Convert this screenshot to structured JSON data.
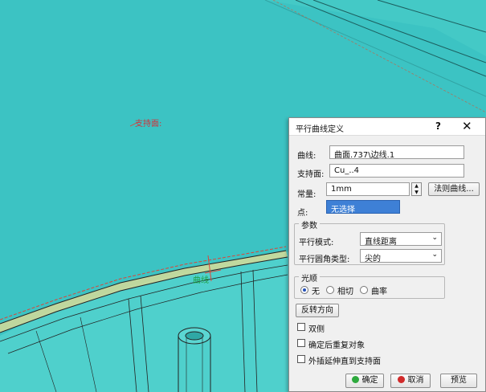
{
  "viewport": {
    "support_label": "支持面:",
    "curve_label": "曲线"
  },
  "dialog": {
    "title": "平行曲线定义",
    "help_glyph": "?",
    "close_glyph": "✕",
    "curve": {
      "label": "曲线:",
      "value": "曲面.737\\边线.1"
    },
    "support": {
      "label": "支持面:",
      "value": "Cu_..4"
    },
    "constant": {
      "label": "常量:",
      "value": "1mm",
      "law_button": "法则曲线..."
    },
    "point": {
      "label": "点:",
      "value": "无选择"
    },
    "params": {
      "title": "参数",
      "mode_label": "平行模式:",
      "mode_value": "直线距离",
      "corner_label": "平行圆角类型:",
      "corner_value": "尖的"
    },
    "smooth": {
      "title": "光顺",
      "options": [
        "无",
        "相切",
        "曲率"
      ],
      "selected": 0
    },
    "reverse_button": "反转方向",
    "checkboxes": [
      "双侧",
      "确定后重复对象",
      "外插延伸直到支持面"
    ],
    "footer": {
      "ok": "确定",
      "cancel": "取消",
      "preview": "预览"
    }
  },
  "colors": {
    "viewport_bg": "#3cc3c3",
    "ok_dot": "#2eaa3e",
    "cancel_dot": "#d12a2a",
    "selection": "#3e80d6"
  }
}
